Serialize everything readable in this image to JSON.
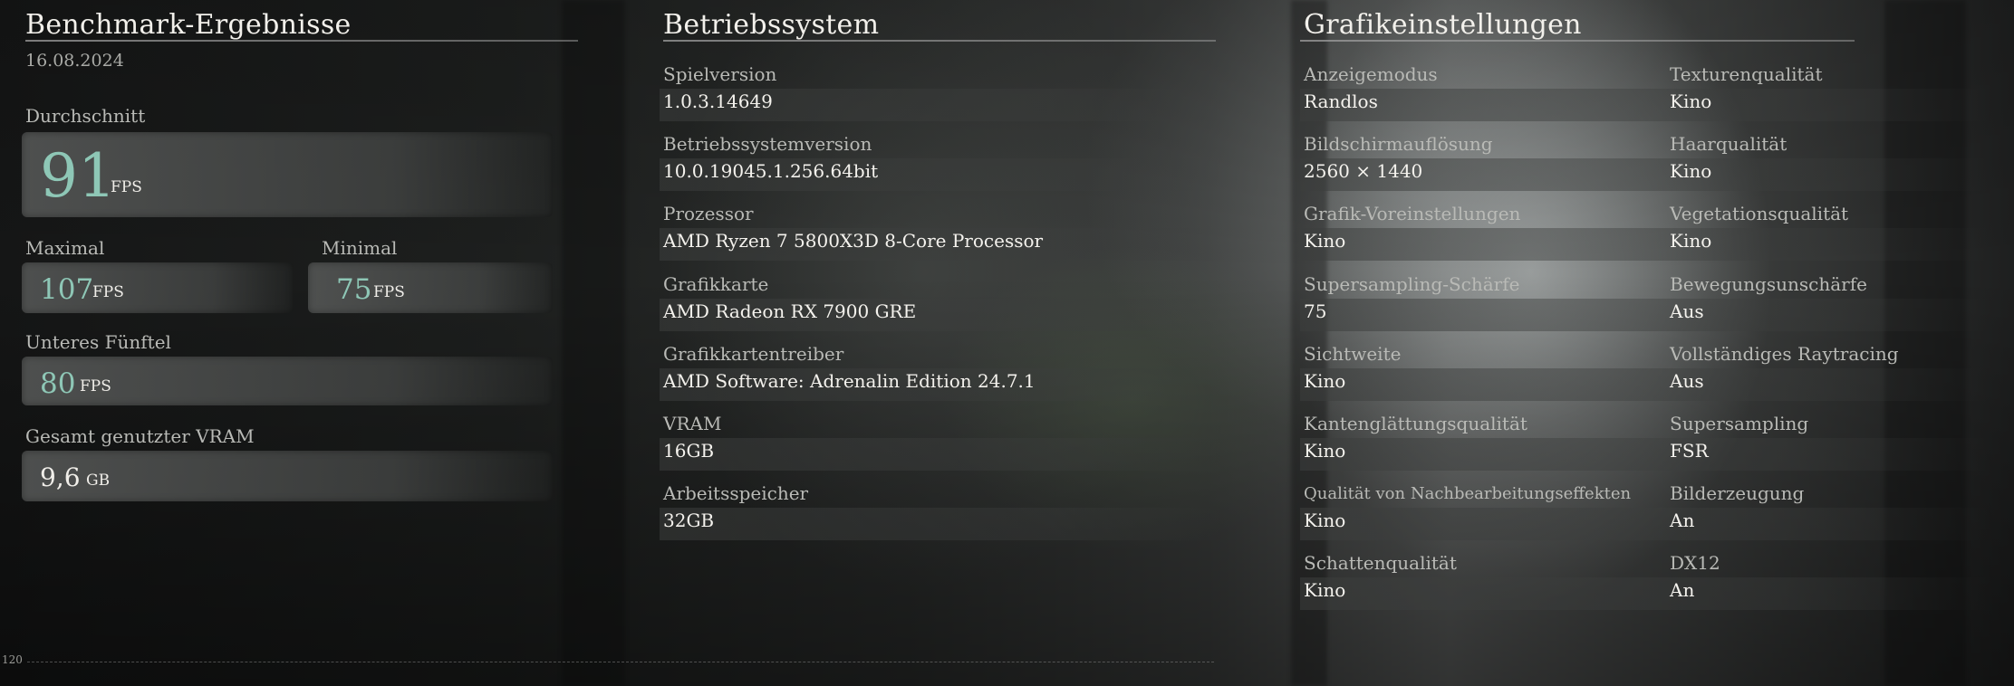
{
  "benchmark": {
    "title": "Benchmark-Ergebnisse",
    "date": "16.08.2024",
    "average": {
      "label": "Durchschnitt",
      "value": "91",
      "unit": "FPS"
    },
    "max": {
      "label": "Maximal",
      "value": "107",
      "unit": "FPS"
    },
    "min": {
      "label": "Minimal",
      "value": "75",
      "unit": "FPS"
    },
    "low": {
      "label": "Unteres Fünftel",
      "value": "80",
      "unit": "FPS"
    },
    "vram": {
      "label": "Gesamt genutzter VRAM",
      "value": "9,6",
      "unit": "GB"
    },
    "graph_axis_value": "120"
  },
  "system": {
    "title": "Betriebssystem",
    "items": [
      {
        "label": "Spielversion",
        "value": "1.0.3.14649"
      },
      {
        "label": "Betriebssystemversion",
        "value": "10.0.19045.1.256.64bit"
      },
      {
        "label": "Prozessor",
        "value": "AMD Ryzen 7 5800X3D 8-Core Processor"
      },
      {
        "label": "Grafikkarte",
        "value": "AMD Radeon RX 7900 GRE"
      },
      {
        "label": "Grafikkartentreiber",
        "value": "AMD Software: Adrenalin Edition 24.7.1"
      },
      {
        "label": "VRAM",
        "value": "16GB"
      },
      {
        "label": "Arbeitsspeicher",
        "value": "32GB"
      }
    ]
  },
  "graphics": {
    "title": "Grafikeinstellungen",
    "left": [
      {
        "label": "Anzeigemodus",
        "value": "Randlos"
      },
      {
        "label": "Bildschirmauflösung",
        "value": "2560 × 1440"
      },
      {
        "label": "Grafik-Voreinstellungen",
        "value": "Kino"
      },
      {
        "label": "Supersampling-Schärfe",
        "value": "75"
      },
      {
        "label": "Sichtweite",
        "value": "Kino"
      },
      {
        "label": "Kantenglättungsqualität",
        "value": "Kino"
      },
      {
        "label": "Qualität von Nachbearbeitungseffekten",
        "value": "Kino"
      },
      {
        "label": "Schattenqualität",
        "value": "Kino"
      }
    ],
    "right": [
      {
        "label": "Texturenqualität",
        "value": "Kino"
      },
      {
        "label": "Haarqualität",
        "value": "Kino"
      },
      {
        "label": "Vegetationsqualität",
        "value": "Kino"
      },
      {
        "label": "Bewegungsunschärfe",
        "value": "Aus"
      },
      {
        "label": "Vollständiges Raytracing",
        "value": "Aus"
      },
      {
        "label": "Supersampling",
        "value": "FSR"
      },
      {
        "label": "Bilderzeugung",
        "value": "An"
      },
      {
        "label": "DX12",
        "value": "An"
      }
    ]
  }
}
